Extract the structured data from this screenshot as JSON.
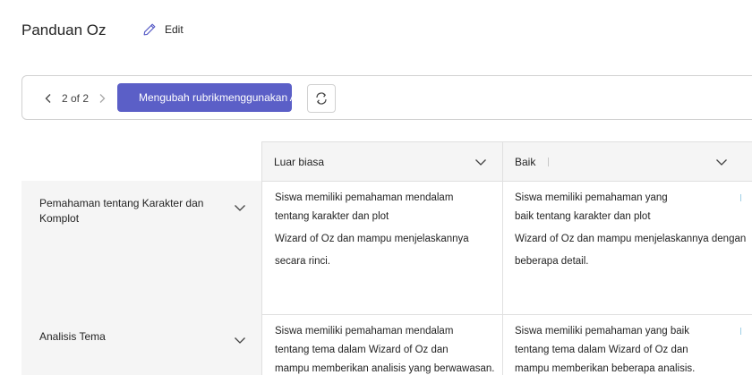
{
  "header": {
    "title": "Panduan Oz",
    "edit_label": "Edit"
  },
  "toolbar": {
    "pager_text": "2 of 2",
    "ai_button_label": "Mengubah rubrikmenggunakan AI"
  },
  "columns": [
    {
      "label": "Luar biasa"
    },
    {
      "label": "Baik"
    }
  ],
  "rows": [
    {
      "label": "Pemahaman tentang Karakter dan Komplot",
      "cells": [
        [
          "Siswa memiliki pemahaman mendalam",
          "tentang karakter dan plot",
          "Wizard of Oz dan mampu menjelaskannya",
          "secara rinci."
        ],
        [
          "Siswa memiliki pemahaman yang",
          "baik tentang karakter dan plot",
          "Wizard of Oz dan mampu menjelaskannya dengan",
          "beberapa detail."
        ]
      ]
    },
    {
      "label": "Analisis Tema",
      "cells": [
        [
          "Siswa memiliki pemahaman mendalam",
          "tentang tema dalam Wizard of Oz dan",
          "mampu memberikan analisis yang berwawasan."
        ],
        [
          "Siswa memiliki pemahaman yang baik",
          "tentang tema dalam Wizard of Oz dan",
          "mampu memberikan beberapa analisis."
        ]
      ]
    }
  ],
  "colors": {
    "accent": "#5b5fc7",
    "header_bg": "#f5f5f5",
    "border": "#e0e0e0"
  },
  "icons": {
    "edit": "pencil-icon",
    "prev": "chevron-left-icon",
    "next": "chevron-right-icon",
    "ai": "sparkle-icon",
    "refresh": "refresh-icon",
    "expand": "chevron-down-icon"
  }
}
